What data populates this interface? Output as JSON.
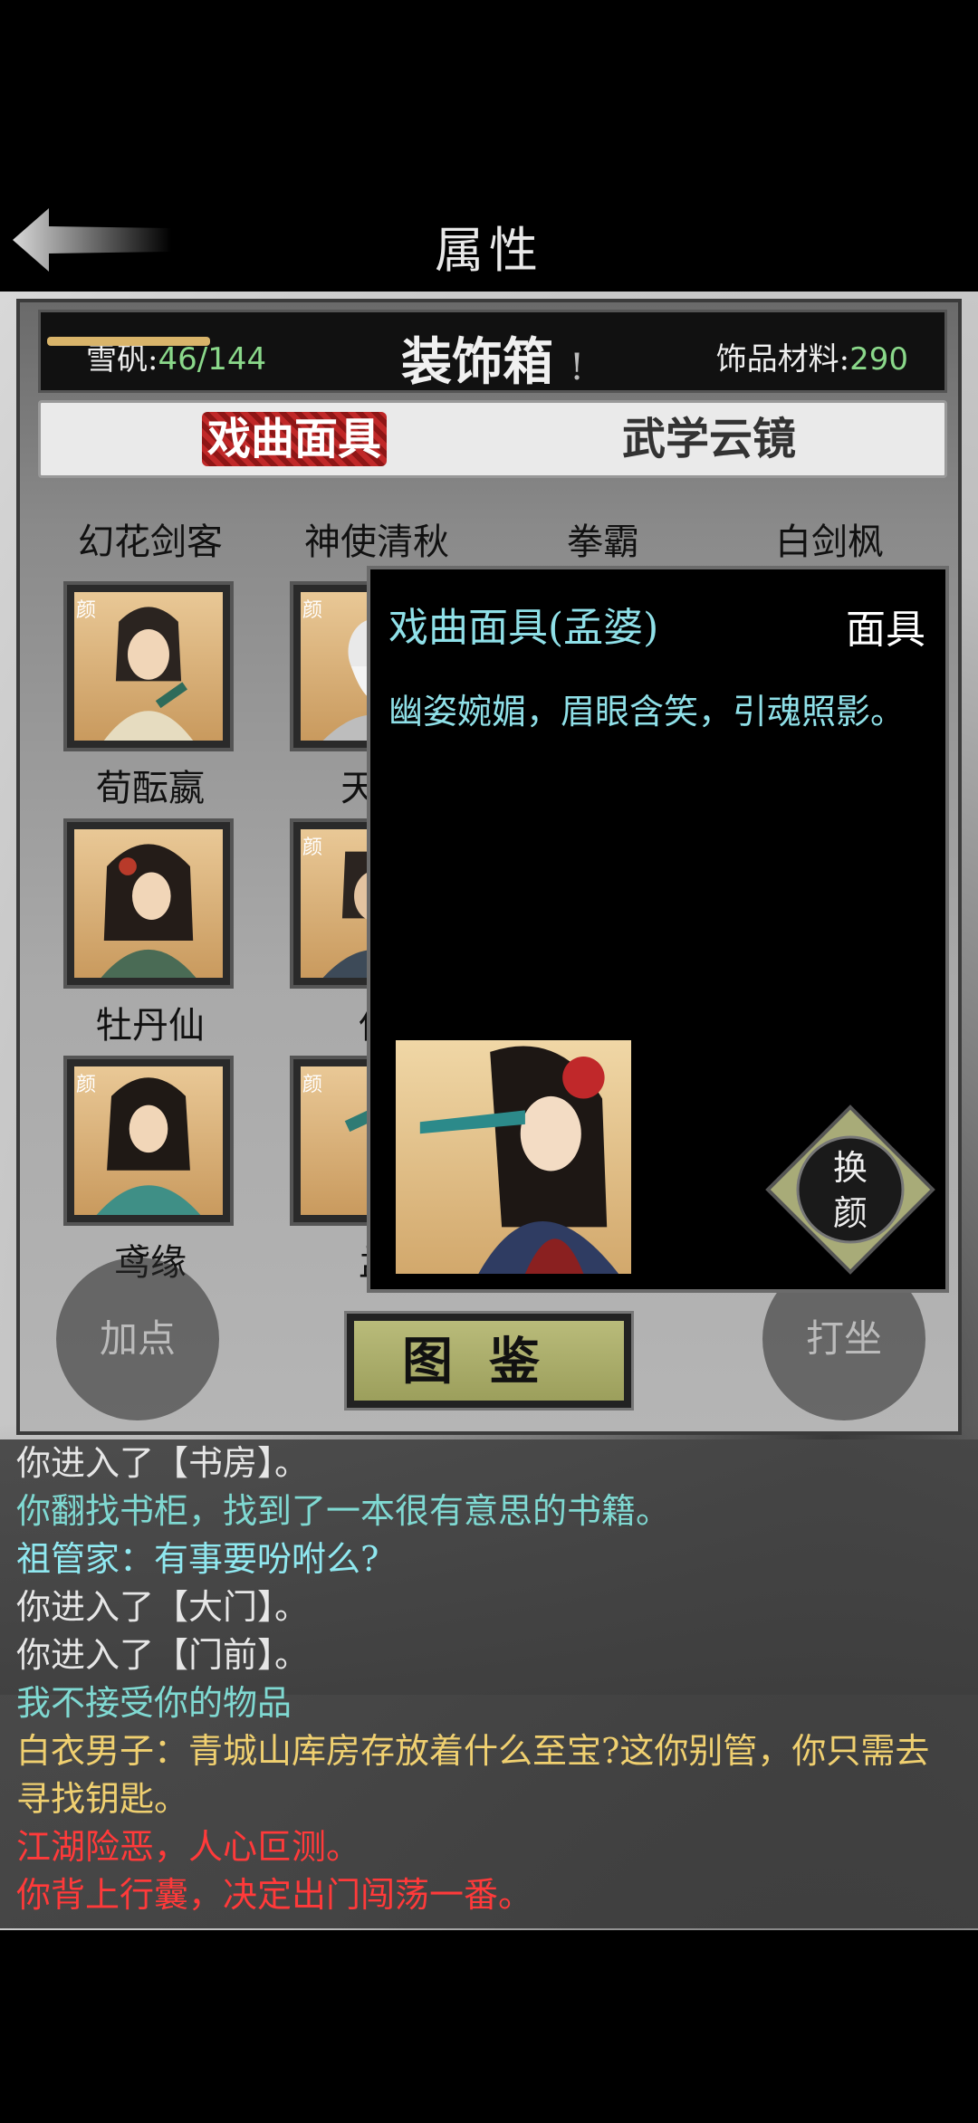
{
  "header": {
    "title": "属性"
  },
  "panel": {
    "stat_left_label": "雪矾:",
    "stat_left_value": "46/144",
    "title": "装饰箱",
    "title_mark": "!",
    "stat_right_label": "饰品材料:",
    "stat_right_value": "290"
  },
  "tabs": [
    {
      "label": "戏曲面具",
      "active": true
    },
    {
      "label": "武学云镜",
      "active": false
    }
  ],
  "grid": {
    "top_names": [
      "幻花剑客",
      "神使清秋",
      "拳霸",
      "白剑枫"
    ],
    "tag": "颜",
    "cards": [
      {
        "name": "荀酝嬴"
      },
      {
        "name": "天机"
      },
      {
        "name": "牡丹仙"
      },
      {
        "name": "伍"
      },
      {
        "name": "鸢缘"
      },
      {
        "name": "孟"
      }
    ]
  },
  "buttons": {
    "add_points": "加点",
    "meditate": "打坐",
    "tujian": "图鉴"
  },
  "popup": {
    "title": "戏曲面具(孟婆)",
    "type": "面具",
    "description": "幽姿婉媚，眉眼含笑，引魂照影。",
    "swap_label_1": "换",
    "swap_label_2": "颜"
  },
  "log": [
    {
      "text": "你进入了【书房】。",
      "color": "#e6e6e6"
    },
    {
      "text": "你翻找书柜，找到了一本很有意思的书籍。",
      "color": "#7fd9d2"
    },
    {
      "text": "祖管家：有事要吩咐么?",
      "color": "#8fe8f0"
    },
    {
      "text": "你进入了【大门】。",
      "color": "#e6e6e6"
    },
    {
      "text": "你进入了【门前】。",
      "color": "#e6e6e6"
    },
    {
      "text": "我不接受你的物品",
      "color": "#7fd9d2"
    },
    {
      "text": "白衣男子：青城山库房存放着什么至宝?这你别管，你只需去寻找钥匙。",
      "color": "#f0d070"
    },
    {
      "text": "江湖险恶，人心叵测。",
      "color": "#ff3a3a"
    },
    {
      "text": "你背上行囊，决定出门闯荡一番。",
      "color": "#ff3a3a"
    }
  ],
  "colors": {
    "accent_cyan": "#8fe0e8",
    "value_green": "#8ad88a",
    "alert_red": "#ff3a3a"
  }
}
